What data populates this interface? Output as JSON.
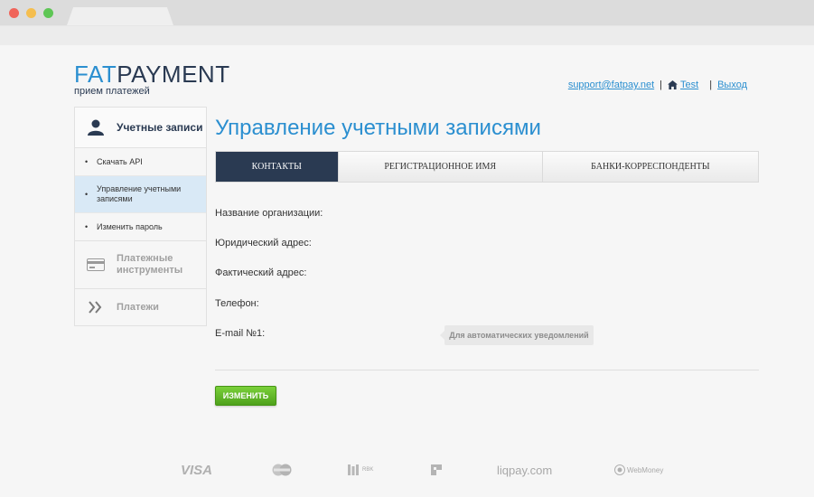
{
  "logo": {
    "fat": "FAT",
    "payment": "PAYMENT",
    "tagline": "прием платежей"
  },
  "top_links": {
    "email": "support@fatpay.net",
    "user": "Test",
    "logout": "Выход",
    "separator": "|"
  },
  "sidebar": {
    "heading": "Учетные записи",
    "items": [
      {
        "label": "Скачать API"
      },
      {
        "label": "Управление учетными записями"
      },
      {
        "label": "Изменить пароль"
      }
    ],
    "groups": [
      {
        "label": "Платежные инструменты",
        "icon": "card-icon"
      },
      {
        "label": "Платежи",
        "icon": "double-chevron-icon"
      }
    ]
  },
  "main": {
    "title": "Управление учетными записями",
    "tabs": [
      {
        "label": "КОНТАКТЫ",
        "active": true
      },
      {
        "label": "РЕГИСТРАЦИОННОЕ ИМЯ",
        "active": false
      },
      {
        "label": "БАНКИ-КОРРЕСПОНДЕНТЫ",
        "active": false
      }
    ],
    "fields": [
      {
        "label": "Название организации:"
      },
      {
        "label": "Юридический адрес:"
      },
      {
        "label": "Фактический адрес:"
      },
      {
        "label": "Телефон:"
      },
      {
        "label": "E-mail №1:"
      }
    ],
    "email_hint": "Для автоматических уведомлений",
    "submit_label": "ИЗМЕНИТЬ"
  },
  "footer": {
    "payment_logos": [
      "VISA",
      "MasterCard",
      "RBK",
      "",
      "liqpay.com",
      "WebMoney"
    ]
  },
  "colors": {
    "accent": "#2b8fd0",
    "navy": "#2a3a52",
    "active_item": "#d9e9f6",
    "button": "#5db424"
  }
}
